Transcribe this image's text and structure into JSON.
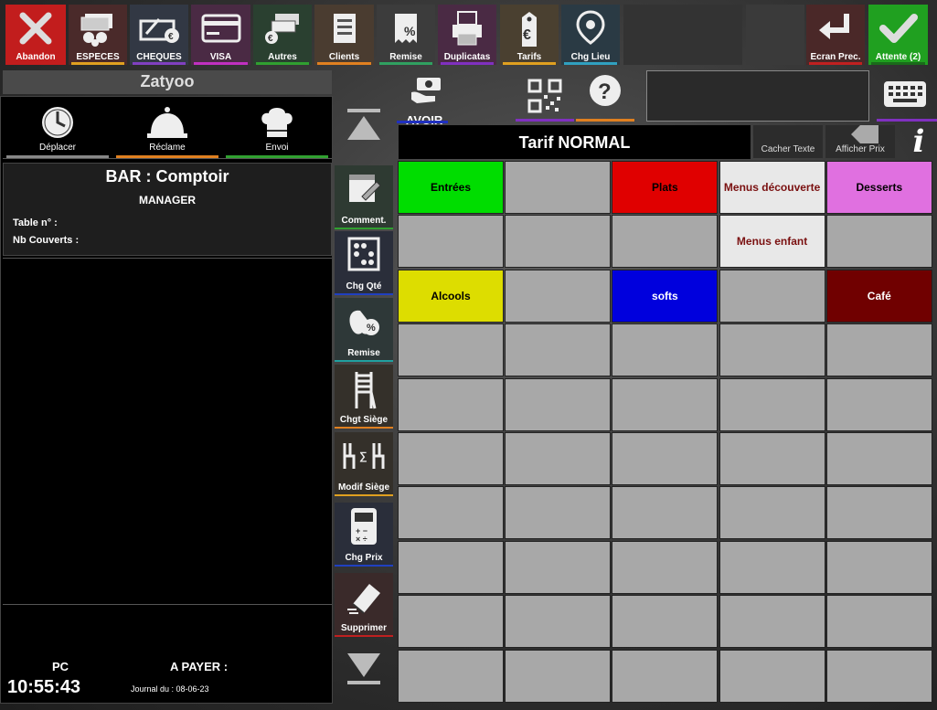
{
  "top_buttons": [
    {
      "label": "Abandon",
      "bg": "#c21d1d",
      "underline": "#c21d1d",
      "icon": "x-icon"
    },
    {
      "label": "ESPECES",
      "bg": "#4a2a2a",
      "underline": "#e0a020",
      "icon": "cash-icon"
    },
    {
      "label": "CHEQUES",
      "bg": "#323844",
      "underline": "#8040c0",
      "icon": "cheque-icon"
    },
    {
      "label": "VISA",
      "bg": "#4a2a44",
      "underline": "#c030c0",
      "icon": "card-icon"
    },
    {
      "label": "Autres",
      "bg": "#2a4030",
      "underline": "#30a030",
      "icon": "cheques-icon"
    },
    {
      "label": "Clients",
      "bg": "#4a3c30",
      "underline": "#e08020",
      "icon": "clients-icon"
    },
    {
      "label": "Remise",
      "bg": "#3c3c3c",
      "underline": "#30a060",
      "icon": "receipt-discount-icon"
    },
    {
      "label": "Duplicatas",
      "bg": "#4a2a44",
      "underline": "#8030c0",
      "icon": "printer-icon"
    },
    {
      "label": "Tarifs",
      "bg": "#4a4030",
      "underline": "#e0a020",
      "icon": "price-tag-icon"
    },
    {
      "label": "Chg Lieu",
      "bg": "#2a3a44",
      "underline": "#30a0c0",
      "icon": "location-pin-icon"
    },
    {
      "label": "Ecran Prec.",
      "bg": "#4a2828",
      "underline": "#c02020",
      "icon": "return-arrow-icon"
    },
    {
      "label": "Attente (2)",
      "bg": "#20a020",
      "underline": "#1a6a1a",
      "icon": "checkmark-icon"
    }
  ],
  "user": "Zatyoo",
  "order_actions": [
    {
      "label": "Déplacer",
      "underline": "#888888",
      "icon": "clock-icon"
    },
    {
      "label": "Réclame",
      "underline": "#e08020",
      "icon": "service-bell-icon"
    },
    {
      "label": "Envoi",
      "underline": "#30a030",
      "icon": "chef-hat-icon"
    }
  ],
  "ticket": {
    "title": "BAR : Comptoir",
    "role": "MANAGER",
    "table": "Table n° :",
    "covers": "Nb Couverts :"
  },
  "footer": {
    "pc": "PC",
    "time": "10:55:43",
    "to_pay": "A PAYER :",
    "journal": "Journal du : 08-06-23"
  },
  "side_buttons": [
    {
      "label": "",
      "underline": "",
      "icon": "scroll-up-icon"
    },
    {
      "label": "Comment.",
      "underline": "#30a030",
      "icon": "comment-calendar-icon"
    },
    {
      "label": "Chg Qté",
      "underline": "#2040c0",
      "icon": "abacus-icon"
    },
    {
      "label": "Remise",
      "underline": "#20a0a0",
      "icon": "apple-discount-icon"
    },
    {
      "label": "Chgt Siège",
      "underline": "#e08020",
      "icon": "chair-icon"
    },
    {
      "label": "Modif Siège",
      "underline": "#e0a020",
      "icon": "chairs-swap-icon"
    },
    {
      "label": "Chg Prix",
      "underline": "#2040c0",
      "icon": "calculator-icon"
    },
    {
      "label": "Supprimer",
      "underline": "#c02020",
      "icon": "eraser-icon"
    },
    {
      "label": "",
      "underline": "",
      "icon": "scroll-down-icon"
    }
  ],
  "avoir": {
    "label": "AVOIR",
    "underline": "#2030c0"
  },
  "tarif": {
    "label": "Tarif NORMAL"
  },
  "toggles": {
    "hide_text": "Cacher Texte",
    "show_price": "Afficher Prix"
  },
  "categories": [
    {
      "label": "Entrées",
      "bg": "#00dd00",
      "color": "#000000"
    },
    {
      "label": "",
      "bg": "#a8a8a8",
      "color": "#000000"
    },
    {
      "label": "Plats",
      "bg": "#e00000",
      "color": "#000000"
    },
    {
      "label": "Menus découverte",
      "bg": "#e8e8e8",
      "color": "#7a1010"
    },
    {
      "label": "Desserts",
      "bg": "#e070e0",
      "color": "#000000"
    },
    {
      "label": "",
      "bg": "#a8a8a8",
      "color": "#000000"
    },
    {
      "label": "",
      "bg": "#a8a8a8",
      "color": "#000000"
    },
    {
      "label": "",
      "bg": "#a8a8a8",
      "color": "#000000"
    },
    {
      "label": "Menus enfant",
      "bg": "#e8e8e8",
      "color": "#7a1010"
    },
    {
      "label": "",
      "bg": "#a8a8a8",
      "color": "#000000"
    },
    {
      "label": "Alcools",
      "bg": "#dddd00",
      "color": "#000000"
    },
    {
      "label": "",
      "bg": "#a8a8a8",
      "color": "#000000"
    },
    {
      "label": "softs",
      "bg": "#0000dd",
      "color": "#ffffff"
    },
    {
      "label": "",
      "bg": "#a8a8a8",
      "color": "#000000"
    },
    {
      "label": "Café",
      "bg": "#700000",
      "color": "#ffffff"
    }
  ]
}
